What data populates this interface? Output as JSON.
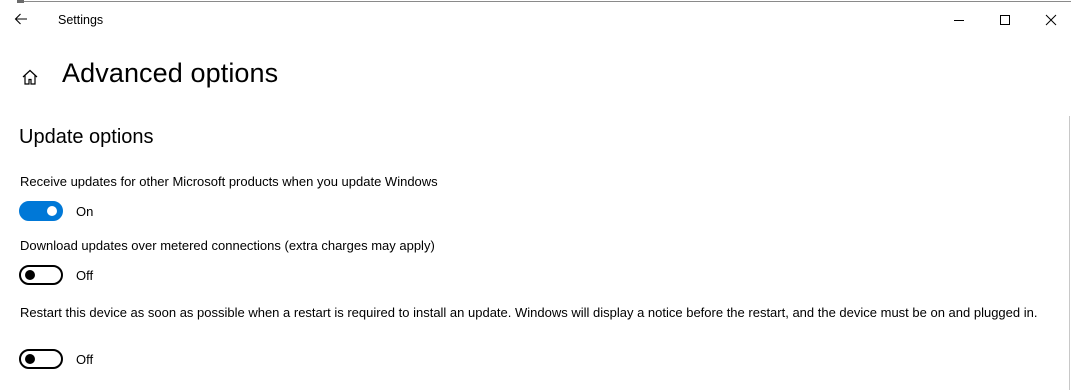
{
  "window": {
    "title": "Settings"
  },
  "titlebar": {
    "back_icon": "back-arrow-icon",
    "minimize_icon": "minimize-icon",
    "maximize_icon": "maximize-icon",
    "close_icon": "close-icon"
  },
  "header": {
    "home_icon": "home-icon",
    "title": "Advanced options"
  },
  "section": {
    "title": "Update options"
  },
  "settings": [
    {
      "label": "Receive updates for other Microsoft products when you update Windows",
      "state": "On",
      "enabled": true
    },
    {
      "label": "Download updates over metered connections (extra charges may apply)",
      "state": "Off",
      "enabled": false
    },
    {
      "label": "Restart this device as soon as possible when a restart is required to install an update. Windows will display a notice before the restart, and the device must be on and plugged in.",
      "state": "Off",
      "enabled": false
    }
  ],
  "colors": {
    "accent": "#0078d7",
    "background": "#ffffff",
    "text": "#000000"
  }
}
